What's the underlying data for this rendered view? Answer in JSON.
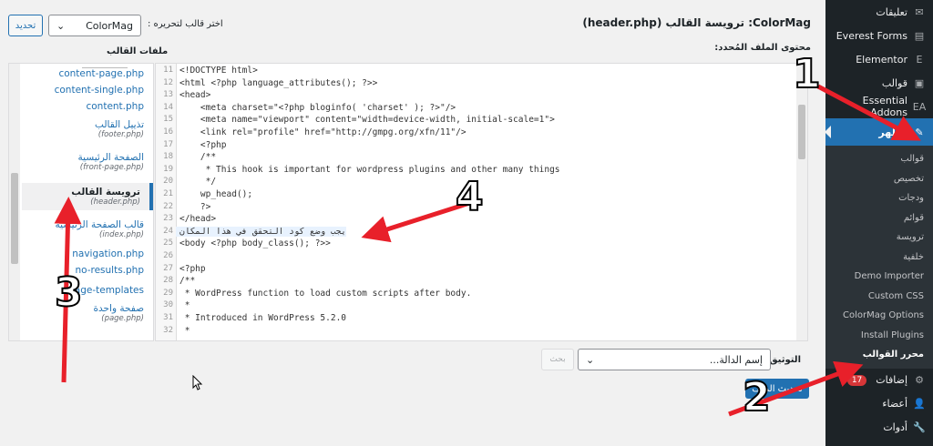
{
  "sidebar": {
    "items": [
      {
        "label": "تعليقات",
        "icon": "comments-icon",
        "glyph": "✉"
      },
      {
        "label": "Everest Forms",
        "icon": "everest-forms-icon",
        "glyph": "▤"
      },
      {
        "label": "Elementor",
        "icon": "elementor-icon",
        "glyph": "E"
      },
      {
        "label": "قوالب",
        "icon": "templates-icon",
        "glyph": "▣"
      },
      {
        "label": "Essential Addons",
        "icon": "essential-addons-icon",
        "glyph": "EA"
      }
    ],
    "active": {
      "label": "مظهر",
      "icon": "paintbrush-icon",
      "glyph": "✎"
    },
    "submenu": [
      "قوالب",
      "تخصيص",
      "ودجات",
      "قوائم",
      "ترويسة",
      "خلفية",
      "Demo Importer",
      "Custom CSS",
      "ColorMag Options",
      "Install Plugins",
      "محرر القوالب"
    ],
    "current_submenu": "محرر القوالب",
    "after": [
      {
        "label": "إضافات",
        "icon": "plugins-icon",
        "glyph": "⚙",
        "badge": "17"
      },
      {
        "label": "أعضاء",
        "icon": "users-icon",
        "glyph": "👤"
      },
      {
        "label": "أدوات",
        "icon": "tools-icon",
        "glyph": "🔧"
      }
    ]
  },
  "header": {
    "title": "ColorMag: ترويسة القالب (header.php)",
    "select_label": "اختر قالب لتحريره :",
    "select_value": "ColorMag",
    "update_label": "تحديد",
    "content_label": "محتوى الملف المُحدد:",
    "files_heading": "ملفات القالب"
  },
  "files": [
    {
      "name": "content-page.php"
    },
    {
      "name": "content-single.php"
    },
    {
      "name": "content.php"
    },
    {
      "name": "تذييل القالب",
      "sub": "(footer.php)"
    },
    {
      "name": "الصفحة الرئيسية",
      "sub": "(front-page.php)"
    },
    {
      "name": "ترويسة القالب",
      "sub": "(header.php)",
      "selected": true
    },
    {
      "name": "قالب الصفحة الرئيسية",
      "sub": "(index.php)"
    },
    {
      "name": "navigation.php"
    },
    {
      "name": "no-results.php"
    },
    {
      "name": "page-templates",
      "folder": true
    },
    {
      "name": "صفحة واحدة",
      "sub": "(page.php)"
    }
  ],
  "editor": {
    "first_line": 11,
    "highlight_line": 24,
    "lines": [
      "<!DOCTYPE html>",
      "<html <?php language_attributes(); ?>>",
      "<head>",
      "    <meta charset=\"<?php bloginfo( 'charset' ); ?>\"/>",
      "    <meta name=\"viewport\" content=\"width=device-width, initial-scale=1\">",
      "    <link rel=\"profile\" href=\"http://gmpg.org/xfn/11\"/>",
      "    <?php",
      "    /**",
      "     * This hook is important for wordpress plugins and other many things",
      "     */",
      "    wp_head();",
      "    ?>",
      "</head>",
      "يجب وضع كود التحقق في هذا المكان",
      "<body <?php body_class(); ?>>",
      "",
      "<?php",
      "/**",
      " * WordPress function to load custom scripts after body.",
      " *",
      " * Introduced in WordPress 5.2.0",
      " *"
    ]
  },
  "docs": {
    "label": "التوثيق:",
    "placeholder": "إسم الدالة...",
    "search_label": "بحث"
  },
  "save_label": "تحديث الملف",
  "annotations": [
    "1",
    "2",
    "3",
    "4"
  ],
  "colors": {
    "accent": "#2271b1",
    "arrow": "#e8202a",
    "sidebar": "#1d2327"
  }
}
